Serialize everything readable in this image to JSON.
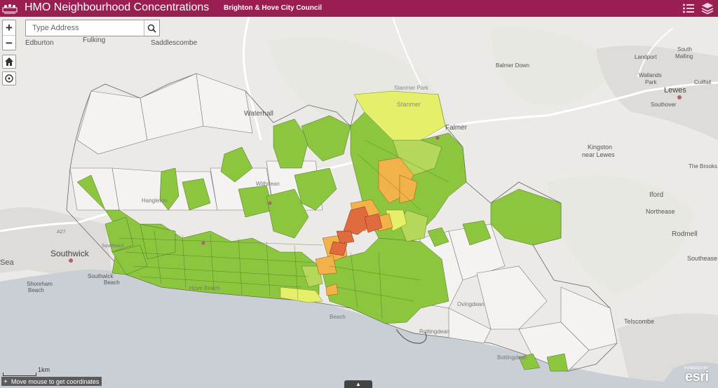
{
  "header": {
    "title": "HMO Neighbourhood Concentrations",
    "council": "Brighton & Hove City Council",
    "bg_color": "#9b1e52"
  },
  "search": {
    "placeholder": "Type Address",
    "value": ""
  },
  "controls": {
    "zoom_in": "+",
    "zoom_out": "−",
    "home_icon": "home-icon",
    "locate_icon": "locate-icon",
    "search_icon": "search-icon",
    "legend_icon": "list-icon",
    "layers_icon": "layers-icon"
  },
  "scale": {
    "label": "1km"
  },
  "coords": {
    "text": "Move mouse to get coordinates",
    "icon": "+"
  },
  "attribution": {
    "toggle": "▲",
    "logo": "esri",
    "logo_small": "POWERED BY"
  },
  "colors": {
    "green": "#8cc63f",
    "light_green": "#b5d85a",
    "yellow": "#e6ef6a",
    "orange": "#f2b24a",
    "red": "#e06b3f",
    "sea": "#c9cfd5",
    "land": "#eceae6"
  },
  "places": [
    {
      "name": "Edburton",
      "size": 10
    },
    {
      "name": "Fulking",
      "size": 10
    },
    {
      "name": "Saddlescombe",
      "size": 10
    },
    {
      "name": "Waterhall",
      "size": 10
    },
    {
      "name": "Stanmer",
      "size": 9
    },
    {
      "name": "Stanmer Park",
      "size": 8
    },
    {
      "name": "Falmer",
      "size": 10
    },
    {
      "name": "Balmer Down",
      "size": 8
    },
    {
      "name": "Landport",
      "size": 8
    },
    {
      "name": "South",
      "size": 8
    },
    {
      "name": "Malling",
      "size": 8
    },
    {
      "name": "Wallands",
      "size": 8
    },
    {
      "name": "Park",
      "size": 8
    },
    {
      "name": "Cuilfail",
      "size": 8
    },
    {
      "name": "Lewes",
      "size": 11
    },
    {
      "name": "Southover",
      "size": 8
    },
    {
      "name": "Kingston",
      "size": 9
    },
    {
      "name": "near Lewes",
      "size": 9
    },
    {
      "name": "The Brooks",
      "size": 8
    },
    {
      "name": "Iford",
      "size": 10
    },
    {
      "name": "Northease",
      "size": 9
    },
    {
      "name": "Rodmell",
      "size": 10
    },
    {
      "name": "Southease",
      "size": 9
    },
    {
      "name": "Telscombe",
      "size": 9
    },
    {
      "name": "Southwick",
      "size": 12
    },
    {
      "name": "Sea",
      "size": 11
    },
    {
      "name": "Southwick",
      "size": 8
    },
    {
      "name": "Beach",
      "size": 8
    },
    {
      "name": "Shoreham",
      "size": 8
    },
    {
      "name": "Beach",
      "size": 8
    },
    {
      "name": "Hove Beach",
      "size": 8
    },
    {
      "name": "Beach",
      "size": 8
    },
    {
      "name": "Rottingdean",
      "size": 8
    },
    {
      "name": "Ovingdean",
      "size": 8
    },
    {
      "name": "Bottingdean",
      "size": 8
    },
    {
      "name": "A27",
      "size": 7
    },
    {
      "name": "Hangleton",
      "size": 8
    },
    {
      "name": "Withdean",
      "size": 8
    },
    {
      "name": "Southwick",
      "size": 7
    }
  ]
}
